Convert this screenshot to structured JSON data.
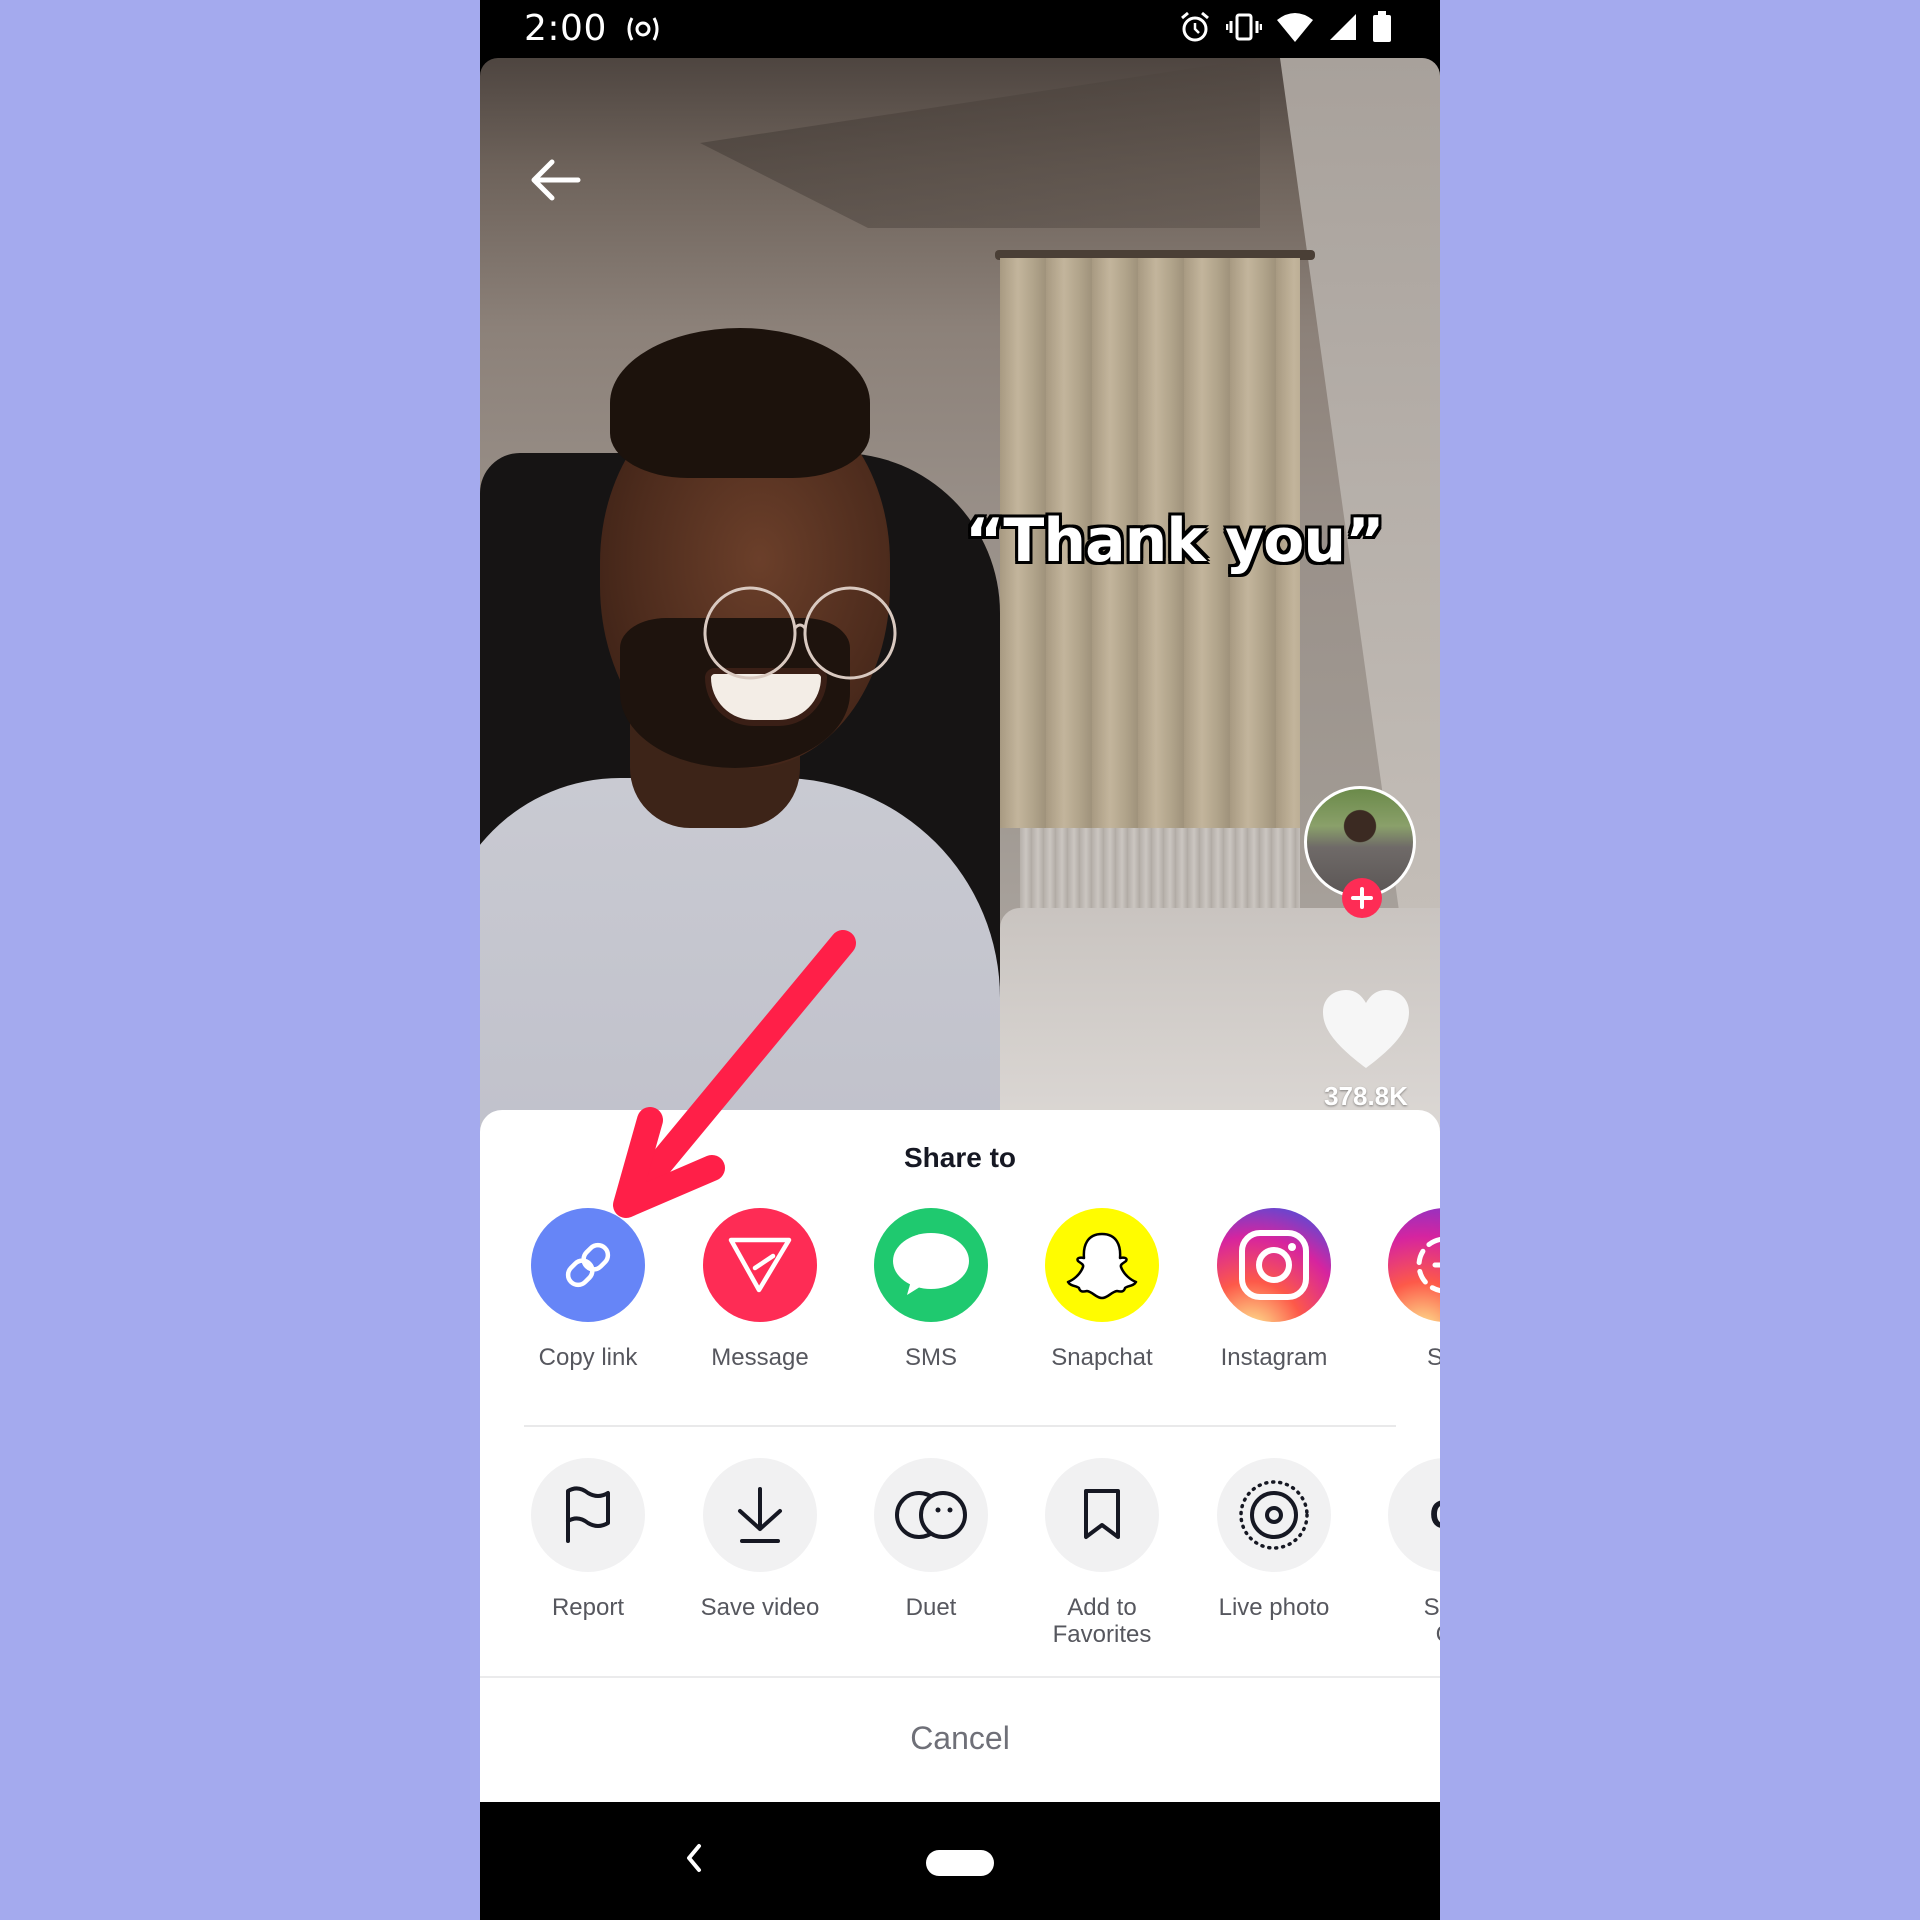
{
  "status_bar": {
    "time": "2:00",
    "icons": [
      "hotspot-icon",
      "alarm-icon",
      "vibrate-icon",
      "wifi-icon",
      "signal-icon",
      "battery-icon"
    ]
  },
  "video": {
    "caption": "“Thank you”",
    "like_count": "378.8K",
    "icons": {
      "back": "arrow-left-icon",
      "follow": "plus-icon",
      "like": "heart-icon"
    }
  },
  "share_sheet": {
    "title": "Share to",
    "share_targets": [
      {
        "label": "Copy link",
        "icon": "link-icon",
        "color": "#6685f7"
      },
      {
        "label": "Message",
        "icon": "send-icon",
        "color": "#fe2c55"
      },
      {
        "label": "SMS",
        "icon": "chat-bubble-icon",
        "color": "#1fc96f"
      },
      {
        "label": "Snapchat",
        "icon": "snapchat-ghost-icon",
        "color": "#fffc00"
      },
      {
        "label": "Instagram",
        "icon": "instagram-icon",
        "color": "#c13584"
      },
      {
        "label": "Sto",
        "icon": "instagram-stories-icon",
        "color": "#9b36b7"
      }
    ],
    "actions": [
      {
        "label": "Report",
        "icon": "flag-icon"
      },
      {
        "label": "Save video",
        "icon": "download-icon"
      },
      {
        "label": "Duet",
        "icon": "duet-icon"
      },
      {
        "label_line1": "Add to",
        "label_line2": "Favorites",
        "icon": "bookmark-icon"
      },
      {
        "label": "Live photo",
        "icon": "live-photo-icon"
      },
      {
        "label_line1": "Sha",
        "label_line2": "G",
        "icon": "gif-icon",
        "glyph": "G"
      }
    ],
    "cancel_label": "Cancel"
  },
  "annotation": {
    "arrow_color": "#ff1f48",
    "points_to": "Copy link"
  },
  "page": {
    "background_color": "#a4aaee"
  }
}
